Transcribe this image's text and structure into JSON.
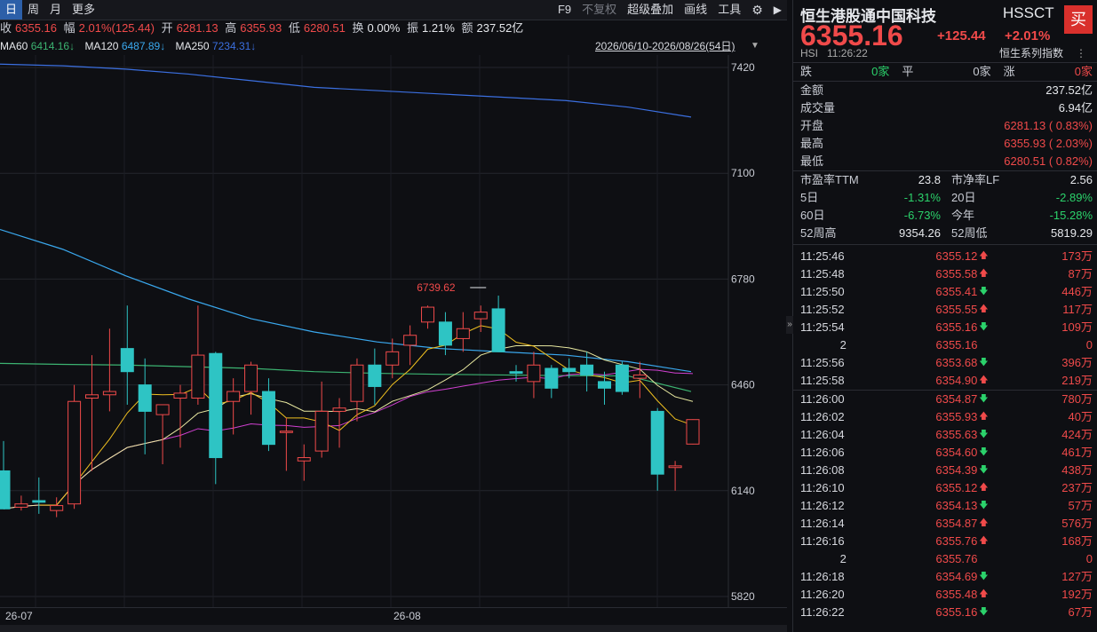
{
  "toolbar": {
    "periods": [
      "日",
      "周",
      "月",
      "更多"
    ],
    "active_period": 0,
    "tools": [
      "F9",
      "不复权",
      "超级叠加",
      "画线",
      "工具"
    ]
  },
  "quote": {
    "close_label": "收",
    "close": "6355.16",
    "change_label": "幅",
    "change": "2.01%(125.44)",
    "open_label": "开",
    "open": "6281.13",
    "high_label": "高",
    "high": "6355.93",
    "low_label": "低",
    "low": "6280.51",
    "turnover_label": "换",
    "turnover": "0.00%",
    "amp_label": "振",
    "amp": "1.21%",
    "amount_label": "额",
    "amount": "237.52亿"
  },
  "ma": {
    "ma60_label": "MA60",
    "ma60": "6414.16↓",
    "ma120_label": "MA120",
    "ma120": "6487.89↓",
    "ma250_label": "MA250",
    "ma250": "7234.31↓",
    "date_range": "2026/06/10-2026/08/26(54日)"
  },
  "colors": {
    "up": "#f04a4a",
    "down": "#2ec4c4",
    "ma250": "#3b6fe0",
    "ma120": "#3aa8ee",
    "ma60": "#3cb371",
    "ma5": "#f0c020",
    "ma10": "#d040d0",
    "ma20": "#e8e8a0",
    "background": "#0e0f13"
  },
  "chart_data": {
    "type": "candlestick",
    "ylim": [
      5820,
      7500
    ],
    "y_ticks": [
      7420,
      7100,
      6780,
      6460,
      6140,
      5820
    ],
    "x_labels": [
      "26-07",
      "26-08"
    ],
    "annotation": "6739.62",
    "candles": [
      {
        "o": 6200,
        "h": 6290,
        "l": 6105,
        "c": 6085
      },
      {
        "o": 6090,
        "h": 6125,
        "l": 6080,
        "c": 6100
      },
      {
        "o": 6110,
        "h": 6180,
        "l": 6070,
        "c": 6105
      },
      {
        "o": 6080,
        "h": 6120,
        "l": 6060,
        "c": 6095
      },
      {
        "o": 6100,
        "h": 6460,
        "l": 6085,
        "c": 6410
      },
      {
        "o": 6420,
        "h": 6550,
        "l": 6200,
        "c": 6430
      },
      {
        "o": 6430,
        "h": 6630,
        "l": 6380,
        "c": 6440
      },
      {
        "o": 6570,
        "h": 6700,
        "l": 6400,
        "c": 6500
      },
      {
        "o": 6460,
        "h": 6540,
        "l": 6250,
        "c": 6380
      },
      {
        "o": 6370,
        "h": 6400,
        "l": 6220,
        "c": 6400
      },
      {
        "o": 6420,
        "h": 6460,
        "l": 6270,
        "c": 6435
      },
      {
        "o": 6420,
        "h": 6700,
        "l": 6400,
        "c": 6550
      },
      {
        "o": 6555,
        "h": 6560,
        "l": 6160,
        "c": 6240
      },
      {
        "o": 6410,
        "h": 6480,
        "l": 6310,
        "c": 6440
      },
      {
        "o": 6440,
        "h": 6530,
        "l": 6370,
        "c": 6520
      },
      {
        "o": 6440,
        "h": 6480,
        "l": 6260,
        "c": 6280
      },
      {
        "o": 6320,
        "h": 6360,
        "l": 6200,
        "c": 6320
      },
      {
        "o": 6230,
        "h": 6280,
        "l": 6170,
        "c": 6240
      },
      {
        "o": 6260,
        "h": 6470,
        "l": 6240,
        "c": 6380
      },
      {
        "o": 6380,
        "h": 6420,
        "l": 6270,
        "c": 6390
      },
      {
        "o": 6410,
        "h": 6540,
        "l": 6350,
        "c": 6520
      },
      {
        "o": 6520,
        "h": 6570,
        "l": 6400,
        "c": 6455
      },
      {
        "o": 6520,
        "h": 6600,
        "l": 6480,
        "c": 6560
      },
      {
        "o": 6580,
        "h": 6640,
        "l": 6520,
        "c": 6610
      },
      {
        "o": 6650,
        "h": 6700,
        "l": 6630,
        "c": 6695
      },
      {
        "o": 6650,
        "h": 6680,
        "l": 6550,
        "c": 6580
      },
      {
        "o": 6600,
        "h": 6680,
        "l": 6560,
        "c": 6630
      },
      {
        "o": 6660,
        "h": 6700,
        "l": 6620,
        "c": 6680
      },
      {
        "o": 6690,
        "h": 6730,
        "l": 6560,
        "c": 6560
      },
      {
        "o": 6500,
        "h": 6520,
        "l": 6470,
        "c": 6495
      },
      {
        "o": 6470,
        "h": 6560,
        "l": 6420,
        "c": 6520
      },
      {
        "o": 6510,
        "h": 6520,
        "l": 6420,
        "c": 6450
      },
      {
        "o": 6510,
        "h": 6540,
        "l": 6480,
        "c": 6500
      },
      {
        "o": 6520,
        "h": 6560,
        "l": 6440,
        "c": 6490
      },
      {
        "o": 6470,
        "h": 6500,
        "l": 6400,
        "c": 6450
      },
      {
        "o": 6520,
        "h": 6530,
        "l": 6430,
        "c": 6440
      },
      {
        "o": 6480,
        "h": 6530,
        "l": 6420,
        "c": 6490
      },
      {
        "o": 6380,
        "h": 6390,
        "l": 6140,
        "c": 6190
      },
      {
        "o": 6210,
        "h": 6230,
        "l": 6140,
        "c": 6215
      },
      {
        "o": 6281,
        "h": 6356,
        "l": 6280,
        "c": 6355
      }
    ],
    "ma250": [
      7430,
      7425,
      7415,
      7400,
      7380,
      7360,
      7350,
      7340,
      7330,
      7320,
      7300,
      7270
    ],
    "ma120": [
      6930,
      6870,
      6790,
      6720,
      6660,
      6620,
      6590,
      6570,
      6560,
      6550,
      6530,
      6500
    ],
    "ma60": [
      6525,
      6522,
      6520,
      6515,
      6510,
      6500,
      6495,
      6492,
      6490,
      6488,
      6487,
      6440
    ]
  },
  "panel": {
    "title": "恒生港股通中国科技",
    "code": "HSSCT",
    "buy": "买",
    "price": "6355.16",
    "change": "+125.44",
    "pct": "+2.01%",
    "market": "HSI",
    "time": "11:26:22",
    "index_series": "恒生系列指数",
    "breadth": {
      "down_label": "跌",
      "down": "0家",
      "flat_label": "平",
      "flat": "0家",
      "up_label": "涨",
      "up": "0家"
    },
    "stats": [
      {
        "label": "金额",
        "value": "237.52亿"
      },
      {
        "label": "成交量",
        "value": "6.94亿"
      },
      {
        "label": "开盘",
        "value": "6281.13 ( 0.83%)"
      },
      {
        "label": "最高",
        "value": "6355.93 ( 2.03%)"
      },
      {
        "label": "最低",
        "value": "6280.51 ( 0.82%)"
      }
    ],
    "valuation": [
      {
        "l1": "市盈率TTM",
        "v1": "23.8",
        "l2": "市净率LF",
        "v2": "2.56"
      },
      {
        "l1": "5日",
        "v1": "-1.31%",
        "l2": "20日",
        "v2": "-2.89%"
      },
      {
        "l1": "60日",
        "v1": "-6.73%",
        "l2": "今年",
        "v2": "-15.28%"
      },
      {
        "l1": "52周高",
        "v1": "9354.26",
        "l2": "52周低",
        "v2": "5819.29"
      }
    ],
    "ticks": [
      {
        "t": "11:25:46",
        "p": "6355.12",
        "d": "up",
        "v": "173万"
      },
      {
        "t": "11:25:48",
        "p": "6355.58",
        "d": "up",
        "v": "87万"
      },
      {
        "t": "11:25:50",
        "p": "6355.41",
        "d": "down",
        "v": "446万"
      },
      {
        "t": "11:25:52",
        "p": "6355.55",
        "d": "up",
        "v": "117万"
      },
      {
        "t": "11:25:54",
        "p": "6355.16",
        "d": "down",
        "v": "109万"
      },
      {
        "t": "2",
        "p": "6355.16",
        "d": "",
        "v": "0"
      },
      {
        "t": "11:25:56",
        "p": "6353.68",
        "d": "down",
        "v": "396万"
      },
      {
        "t": "11:25:58",
        "p": "6354.90",
        "d": "up",
        "v": "219万"
      },
      {
        "t": "11:26:00",
        "p": "6354.87",
        "d": "down",
        "v": "780万"
      },
      {
        "t": "11:26:02",
        "p": "6355.93",
        "d": "up",
        "v": "40万"
      },
      {
        "t": "11:26:04",
        "p": "6355.63",
        "d": "down",
        "v": "424万"
      },
      {
        "t": "11:26:06",
        "p": "6354.60",
        "d": "down",
        "v": "461万"
      },
      {
        "t": "11:26:08",
        "p": "6354.39",
        "d": "down",
        "v": "438万"
      },
      {
        "t": "11:26:10",
        "p": "6355.12",
        "d": "up",
        "v": "237万"
      },
      {
        "t": "11:26:12",
        "p": "6354.13",
        "d": "down",
        "v": "57万"
      },
      {
        "t": "11:26:14",
        "p": "6354.87",
        "d": "up",
        "v": "576万"
      },
      {
        "t": "11:26:16",
        "p": "6355.76",
        "d": "up",
        "v": "168万"
      },
      {
        "t": "2",
        "p": "6355.76",
        "d": "",
        "v": "0"
      },
      {
        "t": "11:26:18",
        "p": "6354.69",
        "d": "down",
        "v": "127万"
      },
      {
        "t": "11:26:20",
        "p": "6355.48",
        "d": "up",
        "v": "192万"
      },
      {
        "t": "11:26:22",
        "p": "6355.16",
        "d": "down",
        "v": "67万"
      }
    ]
  }
}
